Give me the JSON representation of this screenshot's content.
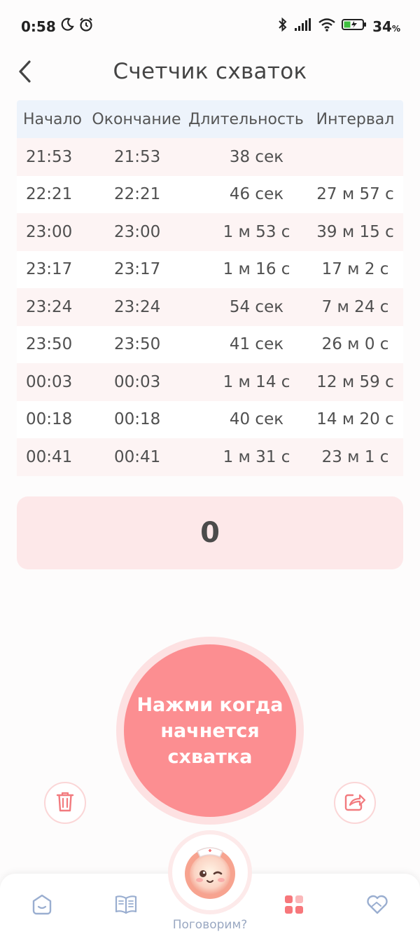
{
  "status_bar": {
    "time": "0:58",
    "battery_percent": "34",
    "battery_suffix": "%"
  },
  "header": {
    "title": "Счетчик схваток"
  },
  "table": {
    "headers": [
      "Начало",
      "Окончание",
      "Длительность",
      "Интервал"
    ],
    "rows": [
      [
        "21:53",
        "21:53",
        "38 сек",
        ""
      ],
      [
        "22:21",
        "22:21",
        "46 сек",
        "27 м 57 с"
      ],
      [
        "23:00",
        "23:00",
        "1 м 53 с",
        "39 м 15 с"
      ],
      [
        "23:17",
        "23:17",
        "1 м 16 с",
        "17 м 2 с"
      ],
      [
        "23:24",
        "23:24",
        "54 сек",
        "7 м 24 с"
      ],
      [
        "23:50",
        "23:50",
        "41 сек",
        "26 м 0 с"
      ],
      [
        "00:03",
        "00:03",
        "1 м 14 с",
        "12 м 59 с"
      ],
      [
        "00:18",
        "00:18",
        "40 сек",
        "14 м 20 с"
      ],
      [
        "00:41",
        "00:41",
        "1 м 31 с",
        "23 м 1 с"
      ]
    ]
  },
  "counter": {
    "value": "0"
  },
  "main_button": {
    "label": "Нажми когда\nначнется\nсхватка"
  },
  "bottom_nav": {
    "assistant_label": "Поговорим?"
  },
  "colors": {
    "accent": "#fc8e91",
    "accent_light": "#fde8e9",
    "header_row": "#edf3fb",
    "nav_icon": "#9aaed0",
    "nav_active": "#f7777b"
  },
  "icons": {
    "back": "chevron-left-icon",
    "delete": "trash-icon",
    "share": "share-icon",
    "home": "home-icon",
    "book": "book-icon",
    "apps": "apps-grid-icon",
    "heart": "heart-hands-icon",
    "assistant": "assistant-avatar-icon"
  }
}
